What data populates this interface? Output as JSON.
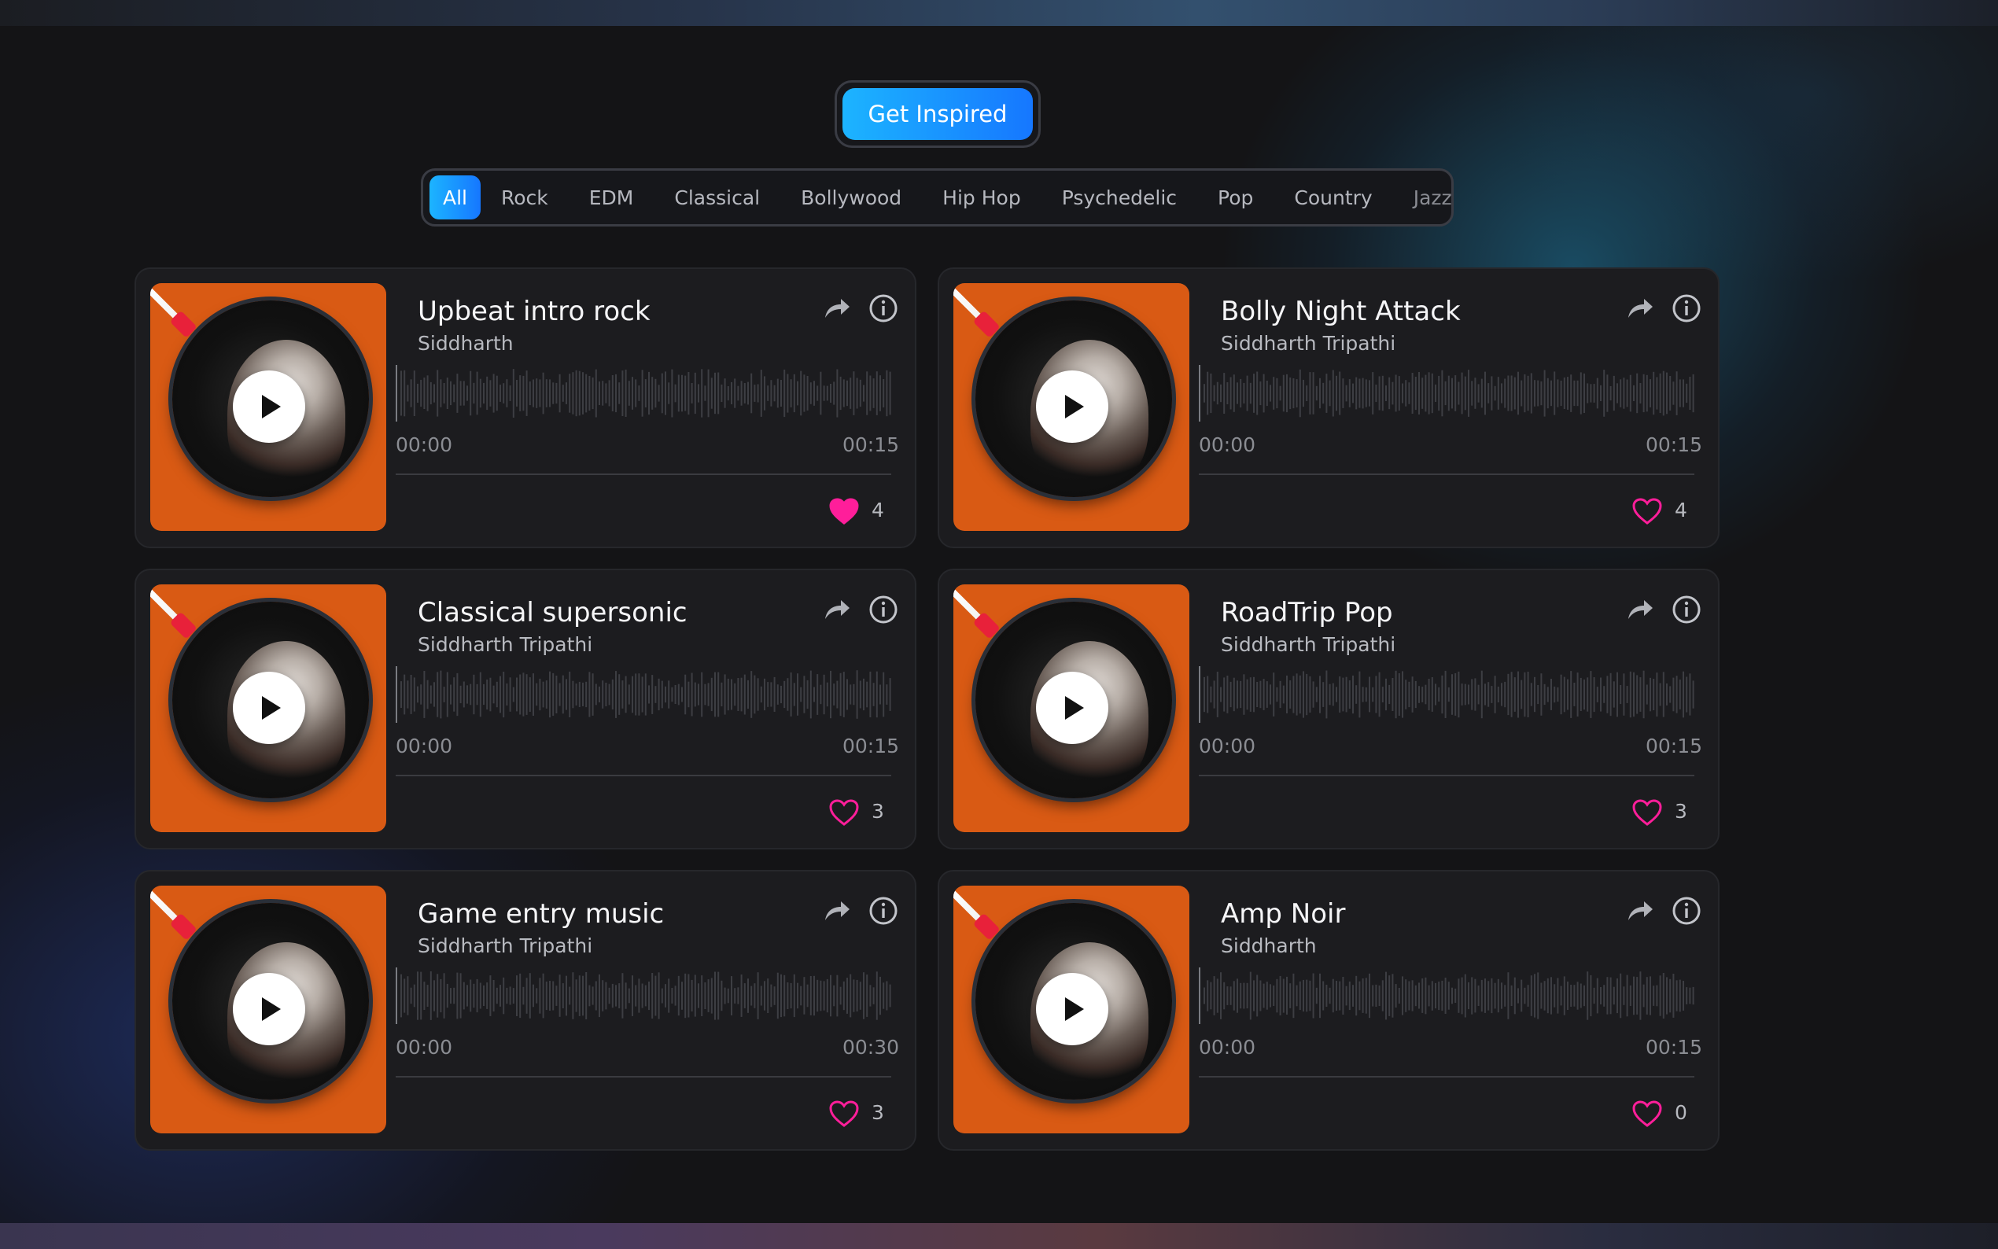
{
  "inspire": {
    "label": "Get Inspired"
  },
  "genres": [
    "All",
    "Rock",
    "EDM",
    "Classical",
    "Bollywood",
    "Hip Hop",
    "Psychedelic",
    "Pop",
    "Country",
    "Jazz"
  ],
  "active_genre": "All",
  "colors": {
    "accent_start": "#1cb4ff",
    "accent_end": "#1677ff",
    "cover": "#d95a14",
    "like": "#ff1e9a"
  },
  "tracks": [
    {
      "title": "Upbeat intro rock",
      "artist": "Siddharth",
      "start": "00:00",
      "end": "00:15",
      "likes": "4",
      "liked": true
    },
    {
      "title": "Bolly Night Attack",
      "artist": "Siddharth Tripathi",
      "start": "00:00",
      "end": "00:15",
      "likes": "4",
      "liked": false
    },
    {
      "title": "Classical supersonic",
      "artist": "Siddharth Tripathi",
      "start": "00:00",
      "end": "00:15",
      "likes": "3",
      "liked": false
    },
    {
      "title": "RoadTrip Pop",
      "artist": "Siddharth Tripathi",
      "start": "00:00",
      "end": "00:15",
      "likes": "3",
      "liked": false
    },
    {
      "title": "Game entry music",
      "artist": "Siddharth Tripathi",
      "start": "00:00",
      "end": "00:30",
      "likes": "3",
      "liked": false
    },
    {
      "title": "Amp Noir",
      "artist": "Siddharth",
      "start": "00:00",
      "end": "00:15",
      "likes": "0",
      "liked": false
    }
  ],
  "icons": {
    "share": "share-arrow-icon",
    "info": "info-icon",
    "like": "heart-icon",
    "play": "play-icon"
  }
}
